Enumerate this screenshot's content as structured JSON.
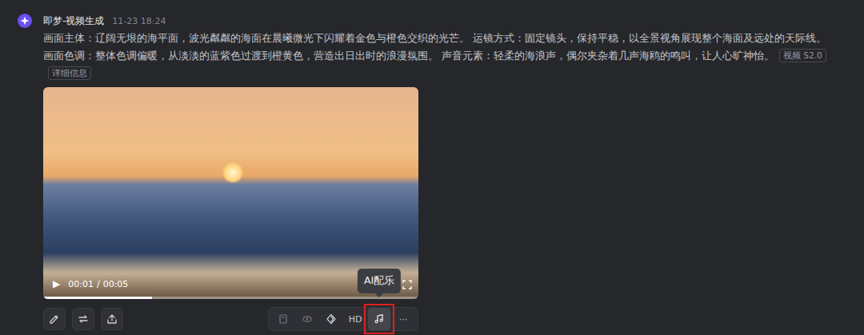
{
  "message": {
    "author": "即梦-视频生成",
    "time": "11-23  18:24",
    "prompt": "画面主体：辽阔无垠的海平面，波光粼粼的海面在晨曦微光下闪耀着金色与橙色交织的光芒。 运镜方式：固定镜头，保持平稳，以全景视角展现整个海面及远处的天际线。 画面色调：整体色调偏暖，从淡淡的蓝紫色过渡到橙黄色，营造出日出时的浪漫氛围。 声音元素：轻柔的海浪声，偶尔夹杂着几声海鸥的鸣叫，让人心旷神怡。",
    "tags": [
      "视频 S2.0",
      "详细信息"
    ]
  },
  "video": {
    "play": "▶",
    "current": "00:01",
    "separator": "/",
    "duration": "00:05",
    "level": 0.29
  },
  "tooltip": "AI配乐",
  "left_buttons": [
    {
      "name": "edit"
    },
    {
      "name": "regenerate"
    },
    {
      "name": "share"
    }
  ],
  "tools": [
    {
      "kind": "icon",
      "name": "frame",
      "disabled": true,
      "highlighted": false
    },
    {
      "kind": "icon",
      "name": "eye",
      "disabled": true,
      "highlighted": false
    },
    {
      "kind": "icon",
      "name": "diamond",
      "disabled": false,
      "highlighted": false
    },
    {
      "kind": "text",
      "text": "HD",
      "disabled": false,
      "highlighted": false
    },
    {
      "kind": "icon",
      "name": "music",
      "disabled": false,
      "highlighted": true
    },
    {
      "kind": "text",
      "text": "···",
      "disabled": false,
      "highlighted": false
    }
  ]
}
